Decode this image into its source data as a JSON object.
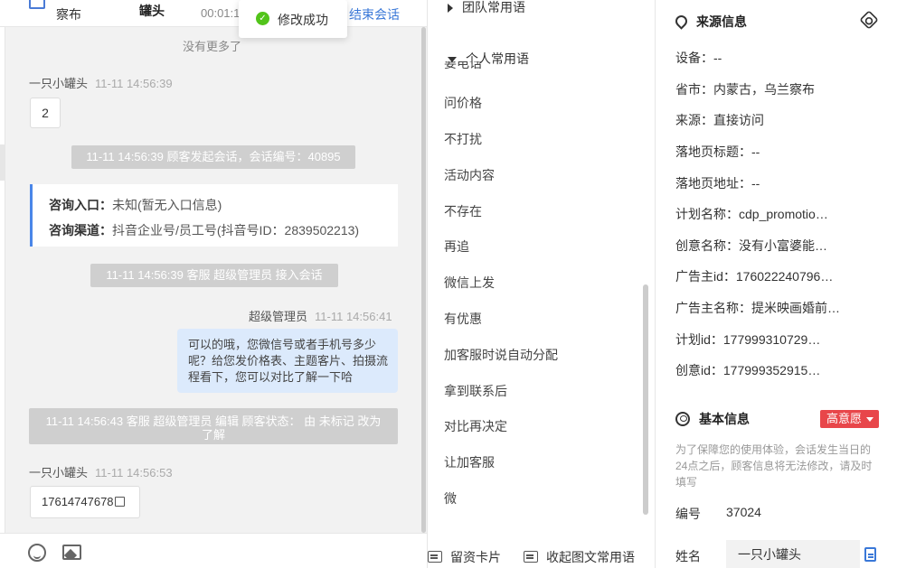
{
  "toast": {
    "text": "修改成功"
  },
  "chat": {
    "header": {
      "name_partial": "察布",
      "name2_partial": "罐头",
      "timer": "00:01:1",
      "end_label": "结束会话"
    },
    "no_more": "没有更多了",
    "msg1": {
      "sender": "一只小罐头",
      "time": "11-11 14:56:39",
      "content": "2"
    },
    "sys1": "11-11 14:56:39 顾客发起会话，会话编号：40895",
    "info": {
      "entry_label": "咨询入口：",
      "entry_value": "未知(暂无入口信息)",
      "channel_label": "咨询渠道：",
      "channel_value": "抖音企业号/员工号(抖音号ID：2839502213)"
    },
    "sys2": "11-11 14:56:39 客服 超级管理员 接入会话",
    "msg2": {
      "sender": "超级管理员",
      "time": "11-11 14:56:41",
      "content": "可以的哦，您微信号或者手机号多少呢？给您发价格表、主题客片、拍摄流程看下，您可以对比了解一下哈"
    },
    "sys3": "11-11 14:56:43 客服 超级管理员 编辑 顾客状态： 由 未标记 改为 了解",
    "msg3": {
      "sender": "一只小罐头",
      "time": "11-11 14:56:53",
      "content": "17614747678"
    }
  },
  "phrases": {
    "team_group": "团队常用语",
    "personal_group": "个人常用语",
    "partial_item": "要电话",
    "items": [
      "问价格",
      "不打扰",
      "活动内容",
      "不存在",
      "再追",
      "微信上发",
      "有优惠",
      "加客服时说自动分配",
      "拿到联系后",
      "对比再决定",
      "让加客服",
      "微"
    ],
    "footer": {
      "card_label": "留资卡片",
      "collect_label": "收起图文常用语"
    }
  },
  "side": {
    "source_title": "来源信息",
    "source_fields": [
      "设备：--",
      "省市：内蒙古，乌兰察布",
      "来源：直接访问",
      "落地页标题：--",
      "落地页地址：--",
      "计划名称：cdp_promotio…",
      "创意名称：没有小富婆能…",
      "广告主id：176022240796…",
      "广告主名称：提米映画婚前…",
      "计划id：177999310729…",
      "创意id：177999352915…"
    ],
    "basic_title": "基本信息",
    "intent_badge": "高意愿",
    "notice": "为了保障您的使用体验，会话发生当日的24点之后，顾客信息将无法修改，请及时填写",
    "id_label": "编号",
    "id_value": "37024",
    "name_label": "姓名",
    "name_value": "一只小罐头"
  }
}
